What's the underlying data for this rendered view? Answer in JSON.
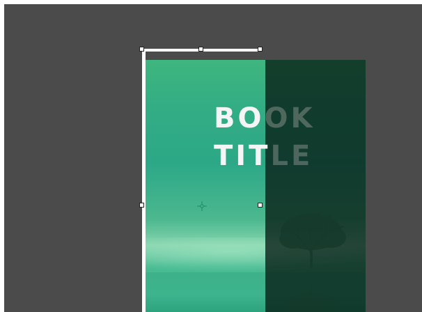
{
  "canvas": {
    "background_color": "#4b4b4b"
  },
  "artwork": {
    "title_line_1": "BOOK",
    "title_line_2": "TITLE",
    "title_line_1_lit": "BO",
    "title_line_1_dim": "OK",
    "title_line_2_lit": "TIT",
    "title_line_2_dim": "LE",
    "accent_color": "#33ad84",
    "shade_color": "#0e2c1f"
  },
  "selection": {
    "frame_color": "#ffffff",
    "handle_icon": "square-handle-icon",
    "center_icon": "crosshair-icon"
  }
}
